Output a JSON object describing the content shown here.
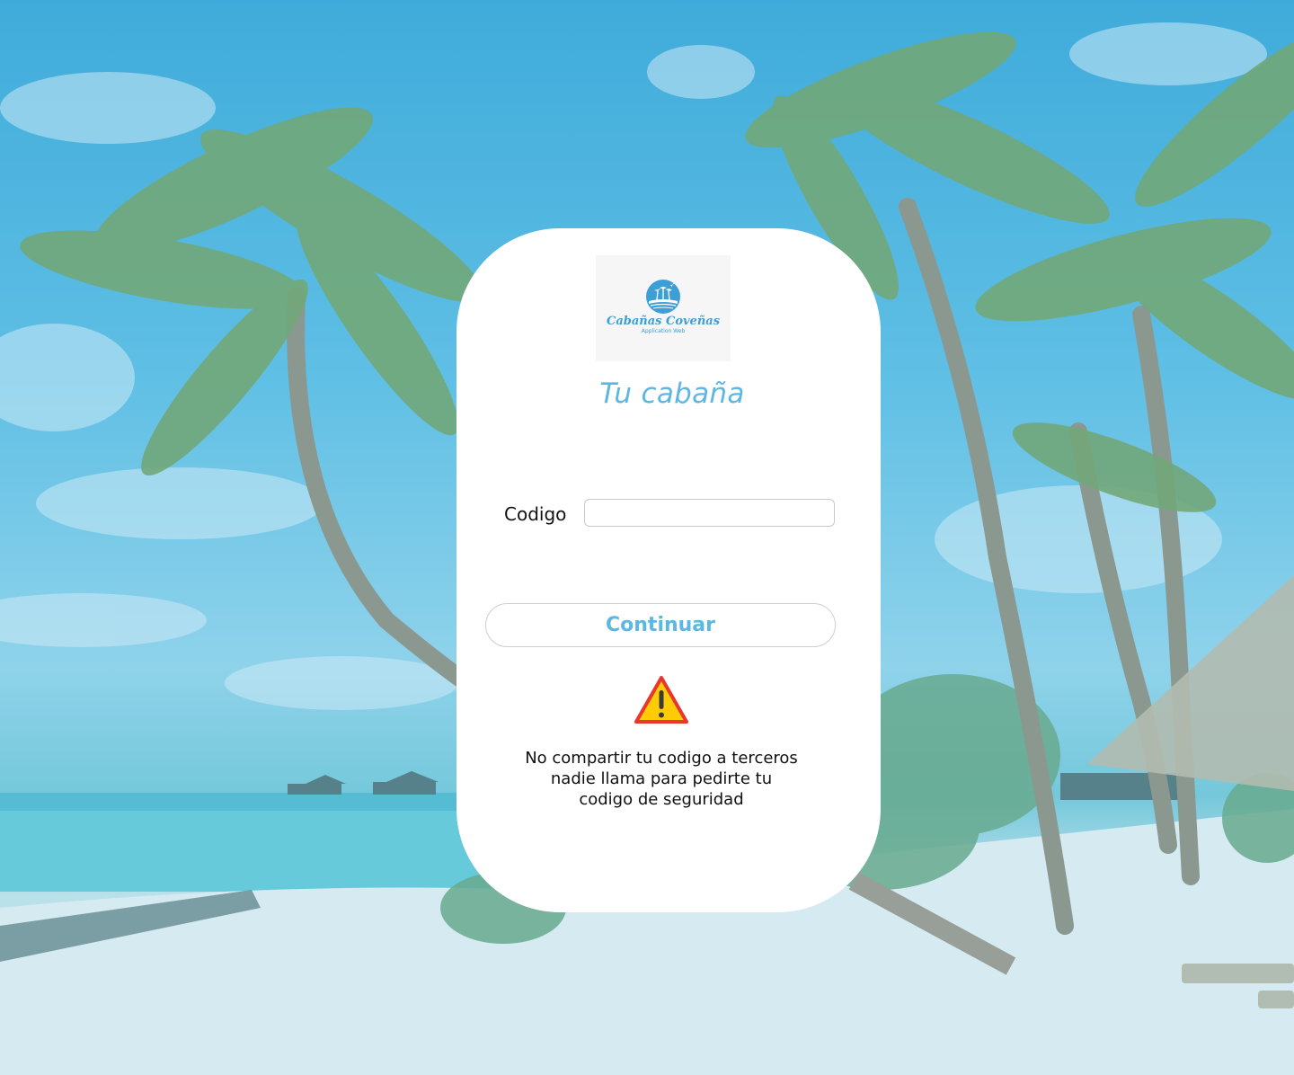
{
  "brand": {
    "logo_name": "Cabañas Coveñas",
    "logo_sub": "Application Web"
  },
  "card": {
    "title": "Tu cabaña",
    "code_label": "Codigo",
    "code_value": "",
    "continue_label": "Continuar",
    "notice_lines": [
      "No compartir tu codigo a terceros",
      "nadie llama para pedirte tu",
      "codigo de seguridad"
    ]
  },
  "icons": {
    "logo": "palm-island-logo-icon",
    "warning": "warning-triangle-icon"
  },
  "colors": {
    "accent": "#5db7e3",
    "logo_blue": "#3d9fd6",
    "warning_fill": "#ffcb05",
    "warning_border": "#e8372e"
  }
}
